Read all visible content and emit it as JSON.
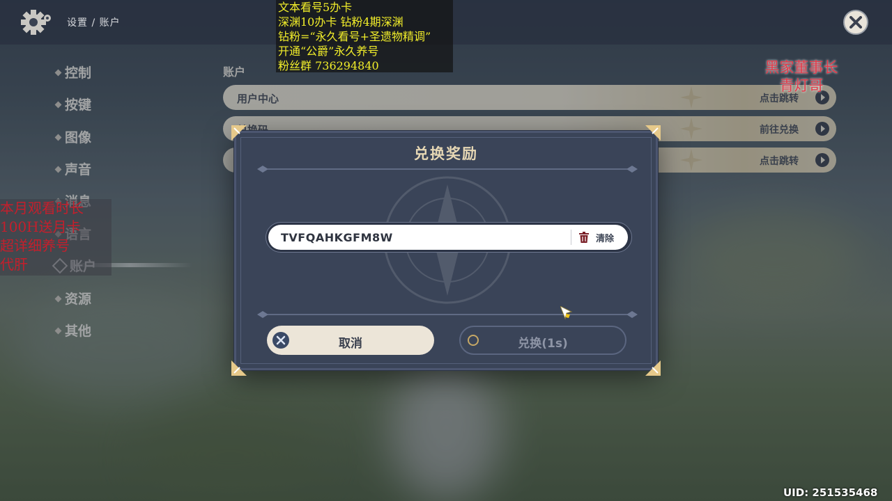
{
  "header": {
    "breadcrumb": "设置 / 账户",
    "settings_icon": "gear-icon",
    "close_icon": "close-icon"
  },
  "sidebar": {
    "items": [
      {
        "label": "控制"
      },
      {
        "label": "按键"
      },
      {
        "label": "图像"
      },
      {
        "label": "声音"
      },
      {
        "label": "消息"
      },
      {
        "label": "语言"
      },
      {
        "label": "账户",
        "active": true
      },
      {
        "label": "资源"
      },
      {
        "label": "其他"
      }
    ]
  },
  "account": {
    "section_title": "账户",
    "rows": [
      {
        "label": "用户中心",
        "action": "点击跳转"
      },
      {
        "label": "兑换码",
        "action": "前往兑换"
      },
      {
        "label": "",
        "action": "点击跳转"
      }
    ]
  },
  "dialog": {
    "title": "兑换奖励",
    "code_value": "TVFQAHKGFM8W",
    "clear_label": "清除",
    "cancel_label": "取消",
    "redeem_label": "兑换(1s)"
  },
  "overlays": {
    "top_lines": [
      "文本看号5办卡",
      "深渊10办卡 钻粉4期深渊",
      "钻粉=“永久看号+圣遗物精调”",
      "开通“公爵”永久养号",
      "粉丝群 736294840"
    ],
    "left_lines": [
      "本月观看时长",
      "100H送月卡",
      "超详细养号",
      "代肝"
    ],
    "right_lines": [
      "黑家董事长",
      "青灯哥"
    ]
  },
  "footer": {
    "uid": "UID: 251535468"
  },
  "colors": {
    "dialog_bg": "#3a4458",
    "title_gold": "#e6d7b4",
    "accent_gold": "#c6a866",
    "overlay_yellow": "#f2ee2a",
    "overlay_red": "#c41f2c"
  }
}
